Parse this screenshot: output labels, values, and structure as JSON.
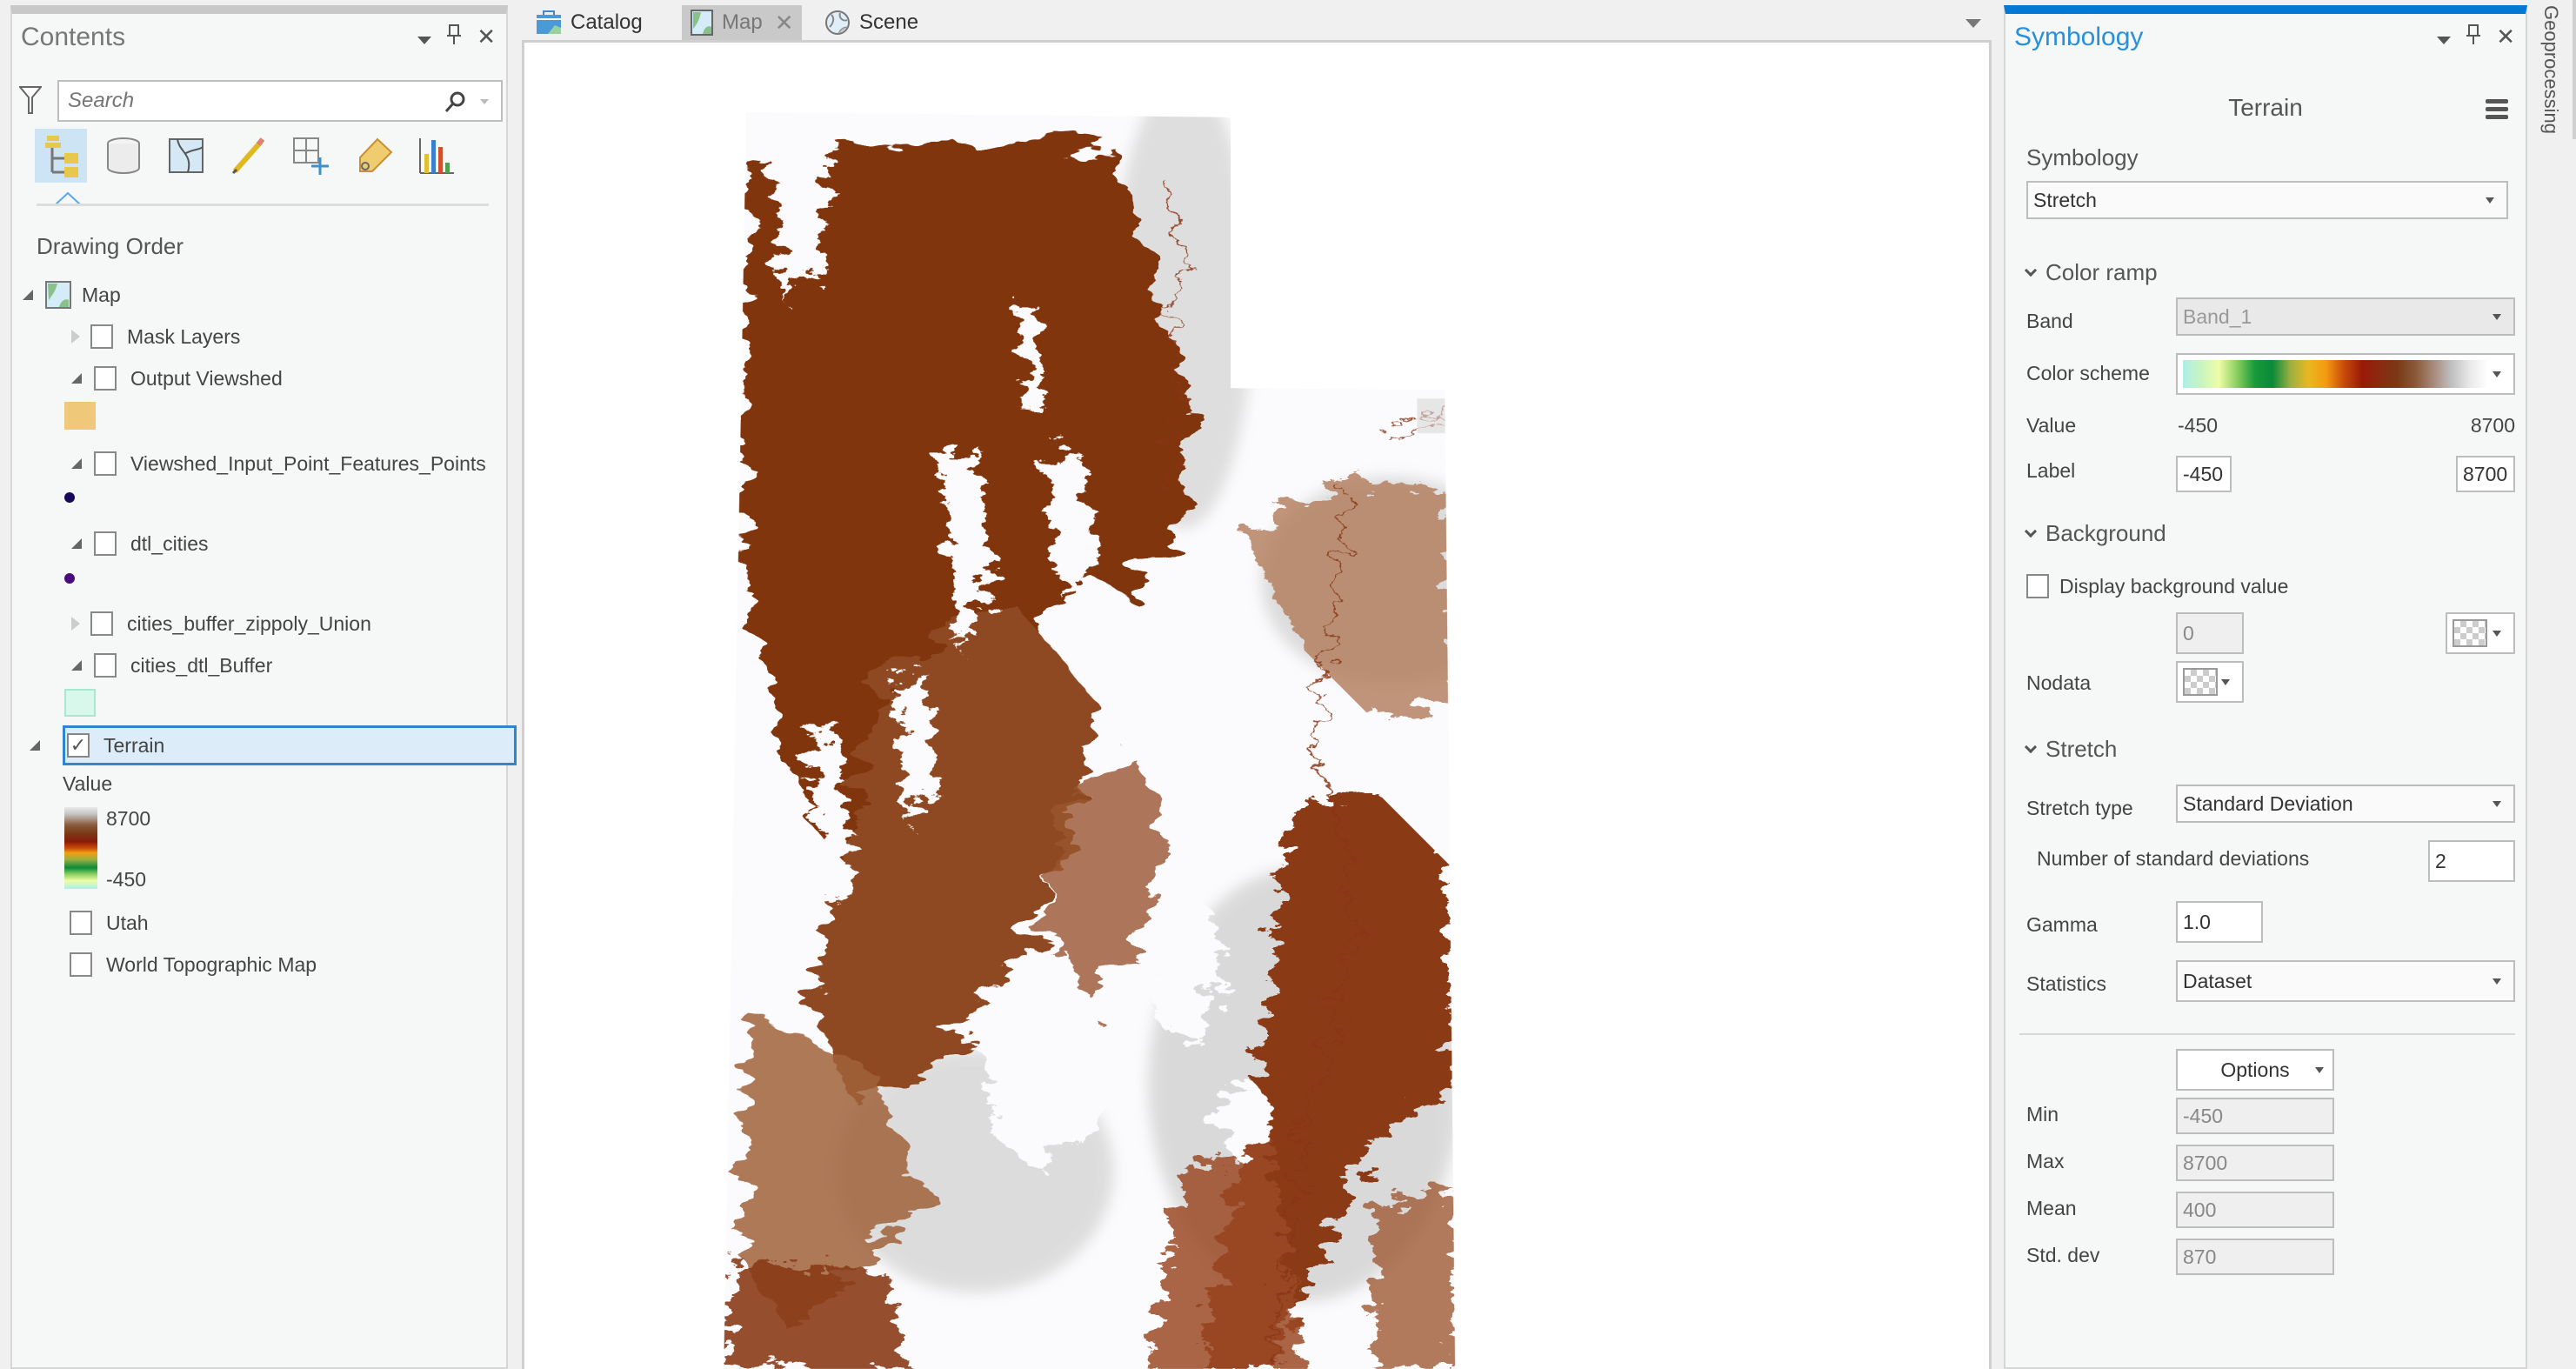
{
  "contents": {
    "title": "Contents",
    "search_placeholder": "Search",
    "toolbar": [
      {
        "name": "list-by-drawing-order-icon",
        "active": true
      },
      {
        "name": "list-by-data-source-icon"
      },
      {
        "name": "list-by-selection-icon"
      },
      {
        "name": "list-by-editing-icon"
      },
      {
        "name": "list-by-snapping-icon"
      },
      {
        "name": "list-by-labeling-icon"
      },
      {
        "name": "list-by-charts-icon"
      }
    ],
    "section_title": "Drawing Order",
    "map_label": "Map",
    "layers": [
      {
        "name": "Mask Layers",
        "expanded": false,
        "checked": false
      },
      {
        "name": "Output Viewshed",
        "expanded": true,
        "checked": false,
        "swatch": "#f0c87a"
      },
      {
        "name": "Viewshed_Input_Point_Features_Points",
        "expanded": true,
        "checked": false,
        "point": "#1b0a5a"
      },
      {
        "name": "dtl_cities",
        "expanded": true,
        "checked": false,
        "point": "#4b0a7a"
      },
      {
        "name": "cities_buffer_zippoly_Union",
        "expanded": false,
        "checked": false
      },
      {
        "name": "cities_dtl_Buffer",
        "expanded": true,
        "checked": false,
        "swatch": "#d8f8ec"
      },
      {
        "name": "Terrain",
        "expanded": true,
        "checked": true,
        "selected": true
      },
      {
        "name": "Utah",
        "checked": false
      },
      {
        "name": "World Topographic Map",
        "checked": false
      }
    ],
    "legend": {
      "title": "Value",
      "high": "8700",
      "low": "-450"
    }
  },
  "map_tabs": [
    {
      "label": "Catalog",
      "icon": "catalog-icon"
    },
    {
      "label": "Map",
      "icon": "map-icon",
      "active": true,
      "closable": true
    },
    {
      "label": "Scene",
      "icon": "scene-globe-icon"
    }
  ],
  "symbology": {
    "title": "Symbology",
    "layer_name": "Terrain",
    "symbology_label": "Symbology",
    "symbology_value": "Stretch",
    "color_ramp": {
      "header": "Color ramp",
      "band_label": "Band",
      "band_value": "Band_1",
      "scheme_label": "Color scheme",
      "scheme_colors": [
        "#aeeee8",
        "#c8f4c0",
        "#eefca8",
        "#8cd060",
        "#1a9a3a",
        "#0a8a3a",
        "#9ab040",
        "#e8b820",
        "#f49a10",
        "#c84a0a",
        "#9a1a08",
        "#8a2a10",
        "#7a3a16",
        "#8a5a3a",
        "#a88a7a",
        "#c0c0c0",
        "#e8e8e8",
        "#ffffff"
      ],
      "value_label": "Value",
      "value_min": "-450",
      "value_max": "8700",
      "label_label": "Label",
      "label_min": "-450",
      "label_max": "8700"
    },
    "background": {
      "header": "Background",
      "display_label": "Display background value",
      "display_checked": false,
      "bg_value": "0",
      "nodata_label": "Nodata"
    },
    "stretch": {
      "header": "Stretch",
      "type_label": "Stretch type",
      "type_value": "Standard Deviation",
      "nstd_label": "Number of standard deviations",
      "nstd_value": "2",
      "gamma_label": "Gamma",
      "gamma_value": "1.0",
      "stats_label": "Statistics",
      "stats_value": "Dataset"
    },
    "options_label": "Options",
    "stats": [
      {
        "label": "Min",
        "value": "-450"
      },
      {
        "label": "Max",
        "value": "8700"
      },
      {
        "label": "Mean",
        "value": "400"
      },
      {
        "label": "Std. dev",
        "value": "870"
      }
    ]
  },
  "side_tab": {
    "label": "Geoprocessing"
  },
  "colors": {
    "accent": "#0078d4",
    "selection": "#dcecf8",
    "terrain_low": "#7f3412",
    "terrain_high": "#ffffff"
  }
}
